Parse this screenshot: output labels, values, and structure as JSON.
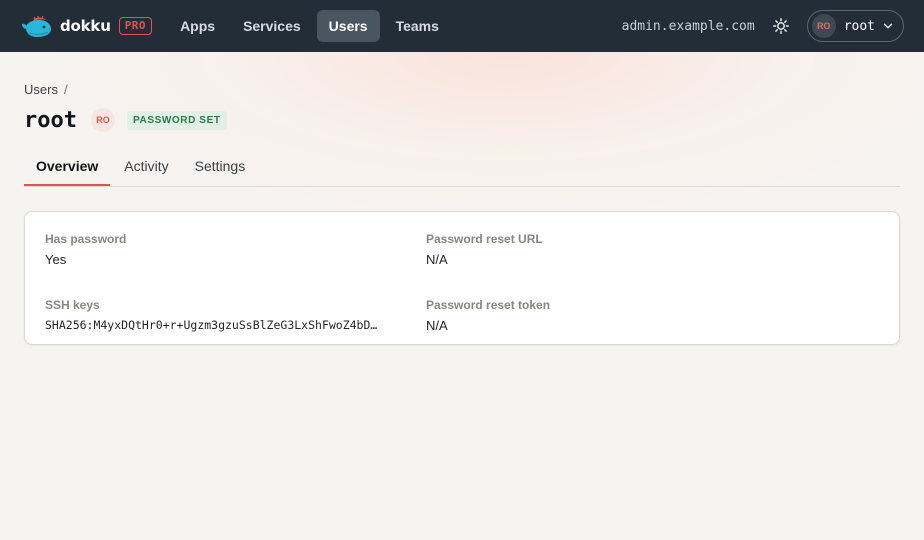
{
  "brand": {
    "name": "dokku",
    "badge": "PRO",
    "accent": "#e0544d"
  },
  "nav": {
    "items": [
      {
        "label": "Apps",
        "active": false
      },
      {
        "label": "Services",
        "active": false
      },
      {
        "label": "Users",
        "active": true
      },
      {
        "label": "Teams",
        "active": false
      }
    ],
    "host": "admin.example.com",
    "theme_icon": "sun-icon",
    "user": {
      "initials": "RO",
      "name": "root"
    }
  },
  "breadcrumb": {
    "parent": "Users",
    "separator": "/"
  },
  "page": {
    "title": "root",
    "avatar_initials": "RO",
    "status_badge": "PASSWORD SET"
  },
  "tabs": [
    {
      "label": "Overview",
      "active": true
    },
    {
      "label": "Activity",
      "active": false
    },
    {
      "label": "Settings",
      "active": false
    }
  ],
  "details": {
    "has_password": {
      "label": "Has password",
      "value": "Yes"
    },
    "password_reset_url": {
      "label": "Password reset URL",
      "value": "N/A"
    },
    "ssh_keys": {
      "label": "SSH keys",
      "value": "SHA256:M4yxDQtHr0+r+Ugzm3gzuSsBlZeG3LxShFwoZ4bD…"
    },
    "password_reset_token": {
      "label": "Password reset token",
      "value": "N/A"
    }
  }
}
